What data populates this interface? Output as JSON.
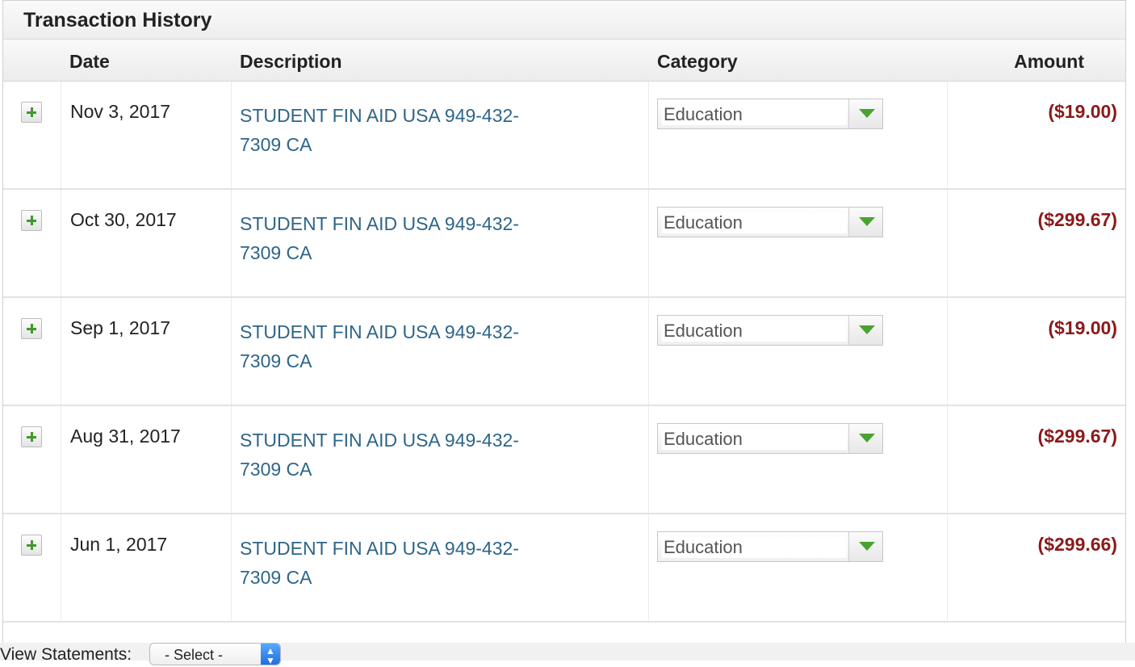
{
  "panel": {
    "title": "Transaction History"
  },
  "table": {
    "columns": {
      "date": "Date",
      "description": "Description",
      "category": "Category",
      "amount": "Amount"
    },
    "rows": [
      {
        "date": "Nov 3, 2017",
        "description": "STUDENT FIN AID USA 949-432-7309 CA",
        "category": "Education",
        "amount": "($19.00)"
      },
      {
        "date": "Oct 30, 2017",
        "description": "STUDENT FIN AID USA 949-432-7309 CA",
        "category": "Education",
        "amount": "($299.67)"
      },
      {
        "date": "Sep 1, 2017",
        "description": "STUDENT FIN AID USA 949-432-7309 CA",
        "category": "Education",
        "amount": "($19.00)"
      },
      {
        "date": "Aug 31, 2017",
        "description": "STUDENT FIN AID USA 949-432-7309 CA",
        "category": "Education",
        "amount": "($299.67)"
      },
      {
        "date": "Jun 1, 2017",
        "description": "STUDENT FIN AID USA 949-432-7309 CA",
        "category": "Education",
        "amount": "($299.66)"
      }
    ]
  },
  "footer": {
    "label": "View Statements:",
    "select_value": "- Select -"
  },
  "icons": {
    "expand": "plus-icon",
    "dropdown": "chevron-down-icon",
    "stepper": "up-down-arrows-icon"
  },
  "colors": {
    "link": "#2e6589",
    "negative_amount": "#8b1a1a",
    "accent_green": "#4aa32f"
  }
}
